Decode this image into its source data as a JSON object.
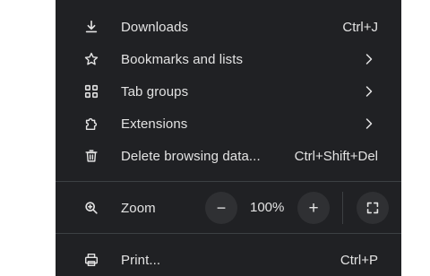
{
  "menu": {
    "items": [
      {
        "label": "Downloads",
        "icon": "download-icon",
        "shortcut": "Ctrl+J"
      },
      {
        "label": "Bookmarks and lists",
        "icon": "star-icon",
        "submenu": true
      },
      {
        "label": "Tab groups",
        "icon": "tab-groups-icon",
        "submenu": true
      },
      {
        "label": "Extensions",
        "icon": "extensions-icon",
        "submenu": true
      },
      {
        "label": "Delete browsing data...",
        "icon": "trash-icon",
        "shortcut": "Ctrl+Shift+Del"
      }
    ],
    "zoom": {
      "label": "Zoom",
      "icon": "zoom-icon",
      "value": "100%",
      "decrease_glyph": "−",
      "increase_glyph": "+"
    },
    "print": {
      "label": "Print...",
      "icon": "printer-icon",
      "shortcut": "Ctrl+P"
    }
  },
  "colors": {
    "menu_background": "#202124",
    "text": "#e3e3e3",
    "divider": "#3c4043",
    "button_background": "#2f3033"
  }
}
